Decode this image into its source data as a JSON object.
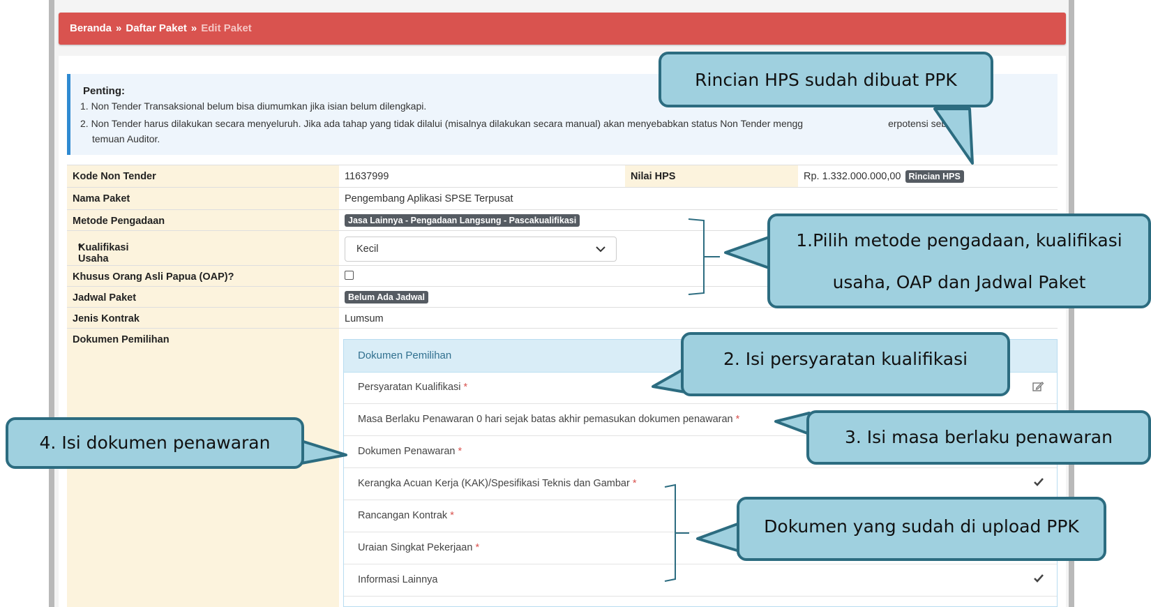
{
  "breadcrumb": {
    "home": "Beranda",
    "sep": "»",
    "list": "Daftar Paket",
    "current": "Edit Paket"
  },
  "alert": {
    "title": "Penting:",
    "line1": "1. Non Tender Transaksional belum bisa diumumkan jika isian belum dilengkapi.",
    "line2a": "2. Non Tender harus dilakukan secara menyeluruh. Jika ada tahap yang tidak dilalui (misalnya dilakukan secara manual) akan menyebabkan status Non Tender mengg",
    "line2b": "erpotensi sebagai",
    "line2c": "temuan Auditor."
  },
  "form": {
    "kode_label": "Kode Non Tender",
    "kode_value": "11637999",
    "hps_label": "Nilai HPS",
    "hps_value": "Rp. 1.332.000.000,00",
    "hps_button": "Rincian HPS",
    "nama_label": "Nama Paket",
    "nama_value": "Pengembang Aplikasi SPSE Terpusat",
    "metode_label": "Metode Pengadaan",
    "metode_value": "Jasa Lainnya - Pengadaan Langsung - Pascakualifikasi",
    "kualifikasi_label": "Kualifikasi Usaha",
    "kualifikasi_value": "Kecil",
    "oap_label": "Khusus Orang Asli Papua (OAP)?",
    "jadwal_label": "Jadwal Paket",
    "jadwal_value": "Belum Ada Jadwal",
    "kontrak_label": "Jenis Kontrak",
    "kontrak_value": "Lumsum",
    "dokumen_label": "Dokumen Pemilihan",
    "required_mark": "*"
  },
  "dokumen": {
    "header": "Dokumen Pemilihan",
    "items": [
      "Persyaratan Kualifikasi",
      "Masa Berlaku Penawaran 0 hari sejak batas akhir pemasukan dokumen penawaran",
      "Dokumen Penawaran",
      "Kerangka Acuan Kerja (KAK)/Spesifikasi Teknis dan Gambar",
      "Rancangan Kontrak",
      "Uraian Singkat Pekerjaan",
      "Informasi Lainnya"
    ]
  },
  "callouts": {
    "hps": "Rincian HPS sudah dibuat PPK",
    "step1a": "1.Pilih metode pengadaan, kualifikasi",
    "step1b": "usaha, OAP dan Jadwal Paket",
    "step2": "2.   Isi persyaratan kualifikasi",
    "step3": "3.   Isi masa berlaku penawaran",
    "step4": "4.   Isi dokumen penawaran",
    "upload": "Dokumen yang sudah di upload PPK"
  },
  "colors": {
    "header_red": "#d9534f",
    "callout_fill": "#9fd0df",
    "callout_border": "#2c6c80",
    "label_bg": "#fcf3dd"
  },
  "icons": [
    "chevron-down-icon",
    "edit-icon",
    "check-icon"
  ]
}
